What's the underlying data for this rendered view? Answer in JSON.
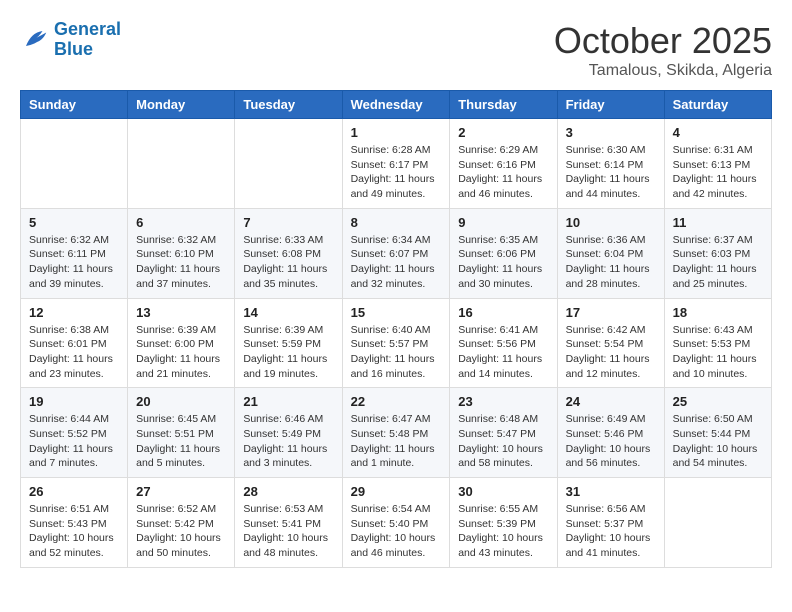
{
  "logo": {
    "line1": "General",
    "line2": "Blue"
  },
  "title": "October 2025",
  "subtitle": "Tamalous, Skikda, Algeria",
  "weekdays": [
    "Sunday",
    "Monday",
    "Tuesday",
    "Wednesday",
    "Thursday",
    "Friday",
    "Saturday"
  ],
  "weeks": [
    [
      {
        "day": "",
        "info": ""
      },
      {
        "day": "",
        "info": ""
      },
      {
        "day": "",
        "info": ""
      },
      {
        "day": "1",
        "info": "Sunrise: 6:28 AM\nSunset: 6:17 PM\nDaylight: 11 hours and 49 minutes."
      },
      {
        "day": "2",
        "info": "Sunrise: 6:29 AM\nSunset: 6:16 PM\nDaylight: 11 hours and 46 minutes."
      },
      {
        "day": "3",
        "info": "Sunrise: 6:30 AM\nSunset: 6:14 PM\nDaylight: 11 hours and 44 minutes."
      },
      {
        "day": "4",
        "info": "Sunrise: 6:31 AM\nSunset: 6:13 PM\nDaylight: 11 hours and 42 minutes."
      }
    ],
    [
      {
        "day": "5",
        "info": "Sunrise: 6:32 AM\nSunset: 6:11 PM\nDaylight: 11 hours and 39 minutes."
      },
      {
        "day": "6",
        "info": "Sunrise: 6:32 AM\nSunset: 6:10 PM\nDaylight: 11 hours and 37 minutes."
      },
      {
        "day": "7",
        "info": "Sunrise: 6:33 AM\nSunset: 6:08 PM\nDaylight: 11 hours and 35 minutes."
      },
      {
        "day": "8",
        "info": "Sunrise: 6:34 AM\nSunset: 6:07 PM\nDaylight: 11 hours and 32 minutes."
      },
      {
        "day": "9",
        "info": "Sunrise: 6:35 AM\nSunset: 6:06 PM\nDaylight: 11 hours and 30 minutes."
      },
      {
        "day": "10",
        "info": "Sunrise: 6:36 AM\nSunset: 6:04 PM\nDaylight: 11 hours and 28 minutes."
      },
      {
        "day": "11",
        "info": "Sunrise: 6:37 AM\nSunset: 6:03 PM\nDaylight: 11 hours and 25 minutes."
      }
    ],
    [
      {
        "day": "12",
        "info": "Sunrise: 6:38 AM\nSunset: 6:01 PM\nDaylight: 11 hours and 23 minutes."
      },
      {
        "day": "13",
        "info": "Sunrise: 6:39 AM\nSunset: 6:00 PM\nDaylight: 11 hours and 21 minutes."
      },
      {
        "day": "14",
        "info": "Sunrise: 6:39 AM\nSunset: 5:59 PM\nDaylight: 11 hours and 19 minutes."
      },
      {
        "day": "15",
        "info": "Sunrise: 6:40 AM\nSunset: 5:57 PM\nDaylight: 11 hours and 16 minutes."
      },
      {
        "day": "16",
        "info": "Sunrise: 6:41 AM\nSunset: 5:56 PM\nDaylight: 11 hours and 14 minutes."
      },
      {
        "day": "17",
        "info": "Sunrise: 6:42 AM\nSunset: 5:54 PM\nDaylight: 11 hours and 12 minutes."
      },
      {
        "day": "18",
        "info": "Sunrise: 6:43 AM\nSunset: 5:53 PM\nDaylight: 11 hours and 10 minutes."
      }
    ],
    [
      {
        "day": "19",
        "info": "Sunrise: 6:44 AM\nSunset: 5:52 PM\nDaylight: 11 hours and 7 minutes."
      },
      {
        "day": "20",
        "info": "Sunrise: 6:45 AM\nSunset: 5:51 PM\nDaylight: 11 hours and 5 minutes."
      },
      {
        "day": "21",
        "info": "Sunrise: 6:46 AM\nSunset: 5:49 PM\nDaylight: 11 hours and 3 minutes."
      },
      {
        "day": "22",
        "info": "Sunrise: 6:47 AM\nSunset: 5:48 PM\nDaylight: 11 hours and 1 minute."
      },
      {
        "day": "23",
        "info": "Sunrise: 6:48 AM\nSunset: 5:47 PM\nDaylight: 10 hours and 58 minutes."
      },
      {
        "day": "24",
        "info": "Sunrise: 6:49 AM\nSunset: 5:46 PM\nDaylight: 10 hours and 56 minutes."
      },
      {
        "day": "25",
        "info": "Sunrise: 6:50 AM\nSunset: 5:44 PM\nDaylight: 10 hours and 54 minutes."
      }
    ],
    [
      {
        "day": "26",
        "info": "Sunrise: 6:51 AM\nSunset: 5:43 PM\nDaylight: 10 hours and 52 minutes."
      },
      {
        "day": "27",
        "info": "Sunrise: 6:52 AM\nSunset: 5:42 PM\nDaylight: 10 hours and 50 minutes."
      },
      {
        "day": "28",
        "info": "Sunrise: 6:53 AM\nSunset: 5:41 PM\nDaylight: 10 hours and 48 minutes."
      },
      {
        "day": "29",
        "info": "Sunrise: 6:54 AM\nSunset: 5:40 PM\nDaylight: 10 hours and 46 minutes."
      },
      {
        "day": "30",
        "info": "Sunrise: 6:55 AM\nSunset: 5:39 PM\nDaylight: 10 hours and 43 minutes."
      },
      {
        "day": "31",
        "info": "Sunrise: 6:56 AM\nSunset: 5:37 PM\nDaylight: 10 hours and 41 minutes."
      },
      {
        "day": "",
        "info": ""
      }
    ]
  ]
}
